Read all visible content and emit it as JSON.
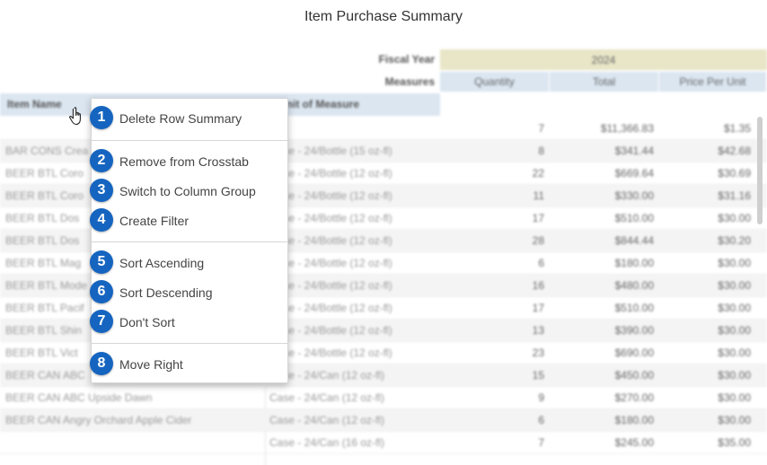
{
  "title": "Item Purchase Summary",
  "header": {
    "fiscal_year_label": "Fiscal Year",
    "fiscal_year_value": "2024",
    "measures_label": "Measures",
    "measures": [
      "Quantity",
      "Total",
      "Price Per Unit"
    ],
    "row_headers": [
      "Item Name",
      "Unit of Measure"
    ]
  },
  "rows": [
    {
      "item": "",
      "unit": "",
      "qty": "7",
      "total": "$11,366.83",
      "ppu": "$1.35"
    },
    {
      "item": "BAR CONS Crea",
      "unit": "Case - 24/Bottle (15 oz-fl)",
      "qty": "8",
      "total": "$341.44",
      "ppu": "$42.68"
    },
    {
      "item": "BEER BTL Coro",
      "unit": "Case - 24/Bottle (12 oz-fl)",
      "qty": "22",
      "total": "$669.64",
      "ppu": "$30.69"
    },
    {
      "item": "BEER BTL Coro",
      "unit": "Case - 24/Bottle (12 oz-fl)",
      "qty": "11",
      "total": "$330.00",
      "ppu": "$31.16"
    },
    {
      "item": "BEER BTL Dos",
      "unit": "Case - 24/Bottle (12 oz-fl)",
      "qty": "17",
      "total": "$510.00",
      "ppu": "$30.00"
    },
    {
      "item": "BEER BTL Dos",
      "unit": "Case - 24/Bottle (12 oz-fl)",
      "qty": "28",
      "total": "$844.44",
      "ppu": "$30.20"
    },
    {
      "item": "BEER BTL Mag",
      "unit": "Case - 24/Bottle (12 oz-fl)",
      "qty": "6",
      "total": "$180.00",
      "ppu": "$30.00"
    },
    {
      "item": "BEER BTL Mode",
      "unit": "Case - 24/Bottle (12 oz-fl)",
      "qty": "16",
      "total": "$480.00",
      "ppu": "$30.00"
    },
    {
      "item": "BEER BTL Pacif",
      "unit": "Case - 24/Bottle (12 oz-fl)",
      "qty": "17",
      "total": "$510.00",
      "ppu": "$30.00"
    },
    {
      "item": "BEER BTL Shin",
      "unit": "Case - 24/Bottle (12 oz-fl)",
      "qty": "13",
      "total": "$390.00",
      "ppu": "$30.00"
    },
    {
      "item": "BEER BTL Vict",
      "unit": "Case - 24/Bottle (12 oz-fl)",
      "qty": "23",
      "total": "$690.00",
      "ppu": "$30.00"
    },
    {
      "item": "BEER CAN ABC",
      "unit": "Case - 24/Can (12 oz-fl)",
      "qty": "15",
      "total": "$450.00",
      "ppu": "$30.00"
    },
    {
      "item": "BEER CAN ABC Upside Dawn",
      "unit": "Case - 24/Can (12 oz-fl)",
      "qty": "9",
      "total": "$270.00",
      "ppu": "$30.00"
    },
    {
      "item": "BEER CAN Angry Orchard Apple Cider",
      "unit": "Case - 24/Can (12 oz-fl)",
      "qty": "6",
      "total": "$180.00",
      "ppu": "$30.00"
    },
    {
      "item": "",
      "unit": "Case - 24/Can (16 oz-fl)",
      "qty": "7",
      "total": "$245.00",
      "ppu": "$35.00"
    }
  ],
  "menu": {
    "items": [
      {
        "num": "1",
        "label": "Delete Row Summary"
      },
      {
        "num": "2",
        "label": "Remove from Crosstab"
      },
      {
        "num": "3",
        "label": "Switch to Column Group"
      },
      {
        "num": "4",
        "label": "Create Filter"
      },
      {
        "num": "5",
        "label": "Sort Ascending"
      },
      {
        "num": "6",
        "label": "Sort Descending"
      },
      {
        "num": "7",
        "label": "Don't Sort"
      },
      {
        "num": "8",
        "label": "Move Right"
      }
    ]
  },
  "colors": {
    "badge": "#1565c0",
    "fiscal_band": "#e8e6c7",
    "measure_band": "#dbe6f1"
  },
  "icons": {
    "cursor": "hand-pointer-icon"
  }
}
